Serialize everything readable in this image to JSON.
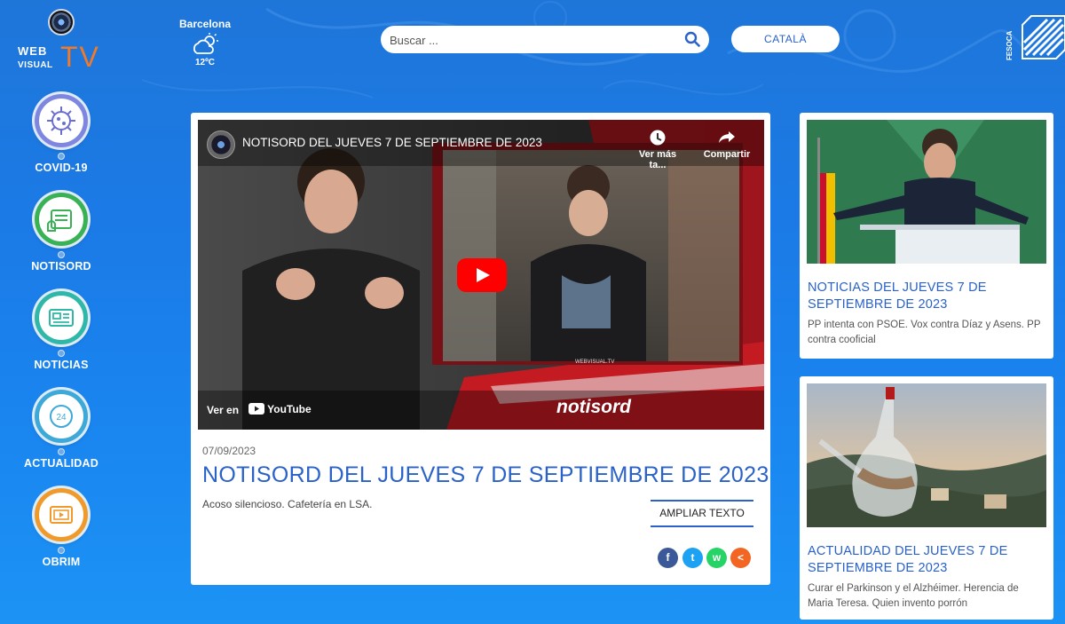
{
  "header": {
    "logo": {
      "web": "WEB",
      "visual": "VISUAL",
      "tv": "TV"
    },
    "weather": {
      "city": "Barcelona",
      "temperature": "12ºC",
      "icon": "partly-cloudy-icon"
    },
    "search": {
      "placeholder": "Buscar ...",
      "value": ""
    },
    "language_button": "CATALÀ",
    "partner_logo": "FESOCA"
  },
  "sidebar": {
    "items": [
      {
        "label": "COVID-19",
        "icon": "virus-icon",
        "color": "#7f86e0"
      },
      {
        "label": "NOTISORD",
        "icon": "sign-language-icon",
        "color": "#38b254"
      },
      {
        "label": "NOTICIAS",
        "icon": "newspaper-icon",
        "color": "#2fb8a8"
      },
      {
        "label": "ACTUALIDAD",
        "icon": "clock-24-icon",
        "color": "#3ea9d8"
      },
      {
        "label": "OBRIM",
        "icon": "video-folder-icon",
        "color": "#f09a2c"
      }
    ]
  },
  "main": {
    "video": {
      "title": "NOTISORD DEL JUEVES 7 DE SEPTIEMBRE DE 2023",
      "watch_later": "Ver más ta...",
      "share": "Compartir",
      "watch_on": "Ver en",
      "youtube": "YouTube",
      "overlay_tag": "notisord",
      "watermark": "WEBVISUAL.TV"
    },
    "date": "07/09/2023",
    "headline": "NOTISORD DEL JUEVES 7 DE SEPTIEMBRE DE 2023",
    "summary": "Acoso silencioso. Cafetería en LSA.",
    "expand_button": "AMPLIAR TEXTO",
    "share_buttons": [
      {
        "name": "facebook",
        "glyph": "f",
        "color": "#3b5998"
      },
      {
        "name": "twitter",
        "glyph": "t",
        "color": "#1da1f2"
      },
      {
        "name": "whatsapp",
        "glyph": "w",
        "color": "#25d366"
      },
      {
        "name": "share",
        "glyph": "<",
        "color": "#f26522"
      }
    ]
  },
  "side_cards": [
    {
      "title": "NOTICIAS DEL JUEVES 7 DE SEPTIEMBRE DE 2023",
      "description": "PP intenta con PSOE. Vox contra Díaz y Asens. PP contra cooficial"
    },
    {
      "title": "ACTUALIDAD DEL JUEVES 7 DE SEPTIEMBRE DE 2023",
      "description": "Curar el Parkinson y el Alzhéimer. Herencia de Maria Teresa. Quien invento porrón"
    }
  ]
}
